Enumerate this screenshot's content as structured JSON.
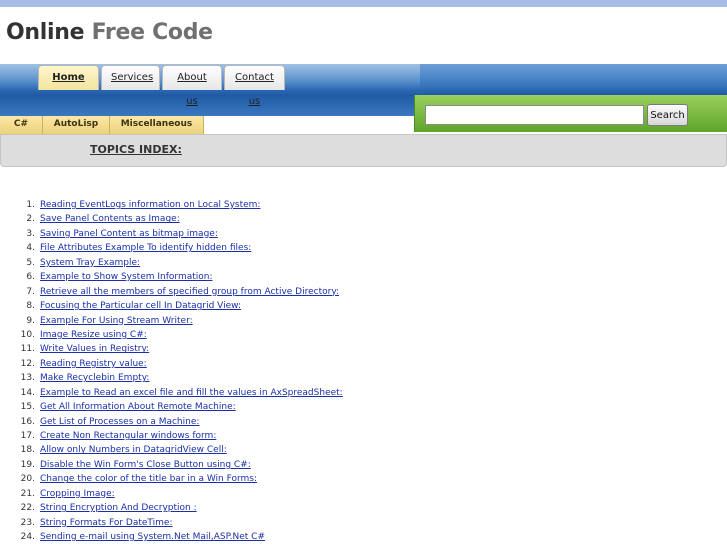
{
  "logo": {
    "part1": "Online",
    "part2": "Free Code"
  },
  "nav": [
    {
      "label": "Home",
      "active": true
    },
    {
      "label": "Services",
      "active": false
    },
    {
      "label": "About us",
      "active": false
    },
    {
      "label": "Contact us",
      "active": false
    }
  ],
  "search": {
    "value": "",
    "button_label": "Search"
  },
  "categories": [
    "C#",
    "AutoLisp",
    "Miscellaneous"
  ],
  "topics_title": "TOPICS INDEX:",
  "topics": [
    "Reading EventLogs information on Local System:",
    "Save Panel Contents as Image:",
    "Saving Panel Content as bitmap image:",
    "File Attributes Example To identify hidden files:",
    "System Tray Example:",
    "Example to Show System Information:",
    "Retrieve all the members of specified group from Active Directory:",
    "Focusing the Particular cell In Datagrid View:",
    "Example For Using Stream Writer:",
    "Image Resize using C#:",
    "Write Values in Registry:",
    "Reading Registry value:",
    "Make Recyclebin Empty:",
    "Example to Read an excel file and fill the values in AxSpreadSheet:",
    "Get All Information About Remote Machine:",
    "Get List of Processes on a Machine:",
    "Create Non Rectangular windows form:",
    "Allow only Numbers in DatagridView Cell:",
    "Disable the Win Form's Close Button using C#:",
    "Change the color of the title bar in a Win Forms:",
    "Cropping Image:",
    "String Encryption And Decryption :",
    "String Formats For DateTime:",
    "Sending e-mail using System.Net Mail,ASP.Net C#"
  ]
}
